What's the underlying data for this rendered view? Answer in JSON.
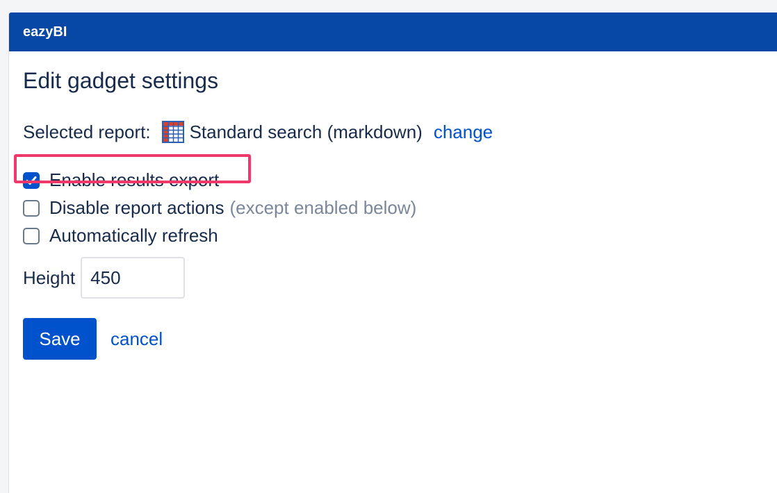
{
  "header": {
    "brand": "eazyBI"
  },
  "page": {
    "title": "Edit gadget settings"
  },
  "report": {
    "label": "Selected report:",
    "icon": "table-icon",
    "name": "Standard search (markdown)",
    "change_label": "change"
  },
  "options": [
    {
      "label": "Enable results export",
      "checked": true,
      "note": ""
    },
    {
      "label": "Disable report actions",
      "checked": false,
      "note": "(except enabled below)"
    },
    {
      "label": "Automatically refresh",
      "checked": false,
      "note": ""
    }
  ],
  "height": {
    "label": "Height",
    "value": "450"
  },
  "actions": {
    "save_label": "Save",
    "cancel_label": "cancel"
  },
  "colors": {
    "header_bg": "#0747a6",
    "primary": "#0052cc",
    "highlight": "#f0386b",
    "text": "#172b4d",
    "muted": "#7a869a"
  }
}
